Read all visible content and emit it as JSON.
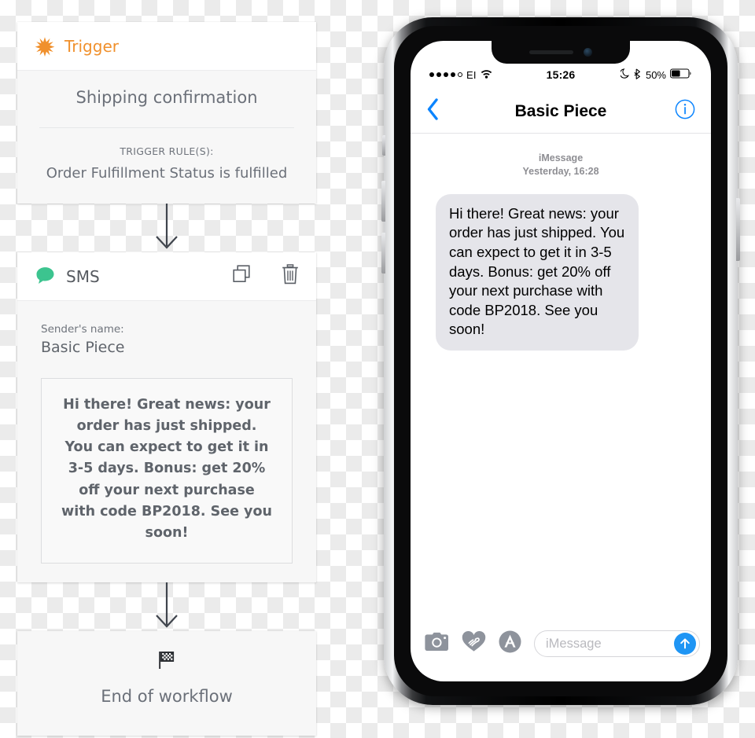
{
  "workflow": {
    "trigger": {
      "header_label": "Trigger",
      "header_icon": "star-burst-icon",
      "accent_color": "#f0902c",
      "title": "Shipping confirmation",
      "rules_label": "TRIGGER RULE(S):",
      "rules_value": "Order Fulfillment Status is fulfilled"
    },
    "sms": {
      "header_label": "SMS",
      "header_icon": "speech-bubble-icon",
      "accent_color": "#3cc48f",
      "duplicate_icon": "copy-icon",
      "delete_icon": "trash-icon",
      "sender_label": "Sender's name:",
      "sender_value": "Basic Piece",
      "message_body": "Hi there! Great news: your order has just shipped. You can expect to get it in 3-5 days. Bonus: get 20% off your next purchase with code BP2018. See you soon!"
    },
    "end": {
      "icon": "checkered-flag-icon",
      "label": "End of workflow"
    }
  },
  "phone": {
    "status_bar": {
      "signal_dots_filled": 4,
      "signal_dots_empty": 1,
      "carrier": "EI",
      "wifi_icon": "wifi-icon",
      "time": "15:26",
      "dnd_icon": "moon-icon",
      "bluetooth_icon": "bluetooth-icon",
      "battery_percent": "50%",
      "battery_icon": "battery-icon"
    },
    "nav": {
      "back_icon": "chevron-left-icon",
      "title": "Basic Piece",
      "info_icon": "info-circle-icon",
      "accent_color": "#0b84fe"
    },
    "thread": {
      "service_label": "iMessage",
      "timestamp": "Yesterday, 16:28",
      "messages": [
        {
          "direction": "incoming",
          "text": "Hi there! Great news: your order has just shipped. You can expect to get it in 3-5 days. Bonus: get 20% off your next purchase with code BP2018. See you soon!",
          "bubble_color": "#e5e5ea"
        }
      ]
    },
    "toolbar": {
      "camera_icon": "camera-icon",
      "digital_touch_icon": "heart-hand-icon",
      "app_store_icon": "app-store-icon",
      "input_placeholder": "iMessage",
      "input_value": "",
      "send_icon": "arrow-up-icon",
      "send_color": "#1f95f4"
    }
  }
}
